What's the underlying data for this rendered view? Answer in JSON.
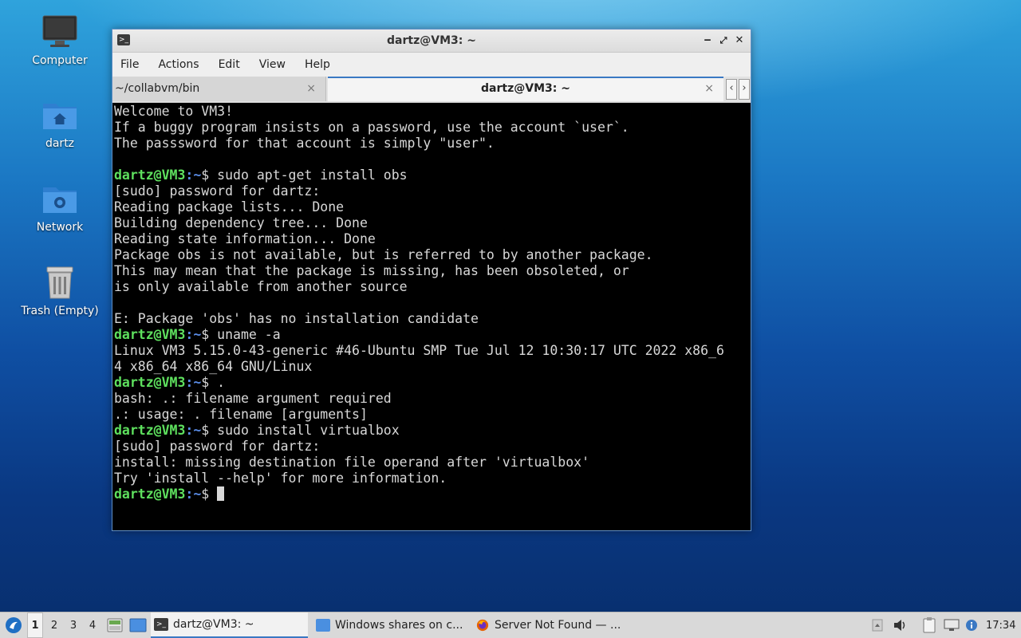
{
  "desktop": {
    "icons": [
      {
        "label": "Computer"
      },
      {
        "label": "dartz"
      },
      {
        "label": "Network"
      },
      {
        "label": "Trash (Empty)"
      }
    ]
  },
  "window": {
    "title": "dartz@VM3: ~",
    "controls": {
      "minimize": "‒",
      "maximize": "⤢",
      "close": "✕"
    },
    "menu": [
      "File",
      "Actions",
      "Edit",
      "View",
      "Help"
    ],
    "tabs": [
      {
        "label": "~/collabvm/bin",
        "active": false
      },
      {
        "label": "dartz@VM3: ~",
        "active": true
      }
    ],
    "tab_close_glyph": "×",
    "tab_nav": {
      "prev": "‹",
      "next": "›"
    }
  },
  "terminal": {
    "prompt_user": "dartz@VM3",
    "prompt_path": ":~",
    "prompt_symbol": "$ ",
    "lines": [
      {
        "text": "Welcome to VM3!"
      },
      {
        "text": "If a buggy program insists on a password, use the account `user`."
      },
      {
        "text": "The passsword for that account is simply \"user\"."
      },
      {
        "text": ""
      },
      {
        "prompt": true,
        "text": "sudo apt-get install obs"
      },
      {
        "text": "[sudo] password for dartz:"
      },
      {
        "text": "Reading package lists... Done"
      },
      {
        "text": "Building dependency tree... Done"
      },
      {
        "text": "Reading state information... Done"
      },
      {
        "text": "Package obs is not available, but is referred to by another package."
      },
      {
        "text": "This may mean that the package is missing, has been obsoleted, or"
      },
      {
        "text": "is only available from another source"
      },
      {
        "text": ""
      },
      {
        "text": "E: Package 'obs' has no installation candidate"
      },
      {
        "prompt": true,
        "text": "uname -a"
      },
      {
        "text": "Linux VM3 5.15.0-43-generic #46-Ubuntu SMP Tue Jul 12 10:30:17 UTC 2022 x86_6"
      },
      {
        "text": "4 x86_64 x86_64 GNU/Linux"
      },
      {
        "prompt": true,
        "text": "."
      },
      {
        "text": "bash: .: filename argument required"
      },
      {
        "text": ".: usage: . filename [arguments]"
      },
      {
        "prompt": true,
        "text": "sudo install virtualbox"
      },
      {
        "text": "[sudo] password for dartz:"
      },
      {
        "text": "install: missing destination file operand after 'virtualbox'"
      },
      {
        "text": "Try 'install --help' for more information."
      },
      {
        "prompt": true,
        "text": "",
        "cursor": true
      }
    ]
  },
  "taskbar": {
    "workspaces": [
      "1",
      "2",
      "3",
      "4"
    ],
    "active_workspace": "1",
    "tasks": [
      {
        "label": "dartz@VM3: ~",
        "icon": "terminal-icon",
        "active": true
      },
      {
        "label": "Windows shares on c...",
        "icon": "folder-icon",
        "active": false
      },
      {
        "label": "Server Not Found — ...",
        "icon": "firefox-icon",
        "active": false
      }
    ],
    "clock": "17:34"
  },
  "colors": {
    "prompt_user": "#5ee05e",
    "prompt_path": "#5a8ce6",
    "accent": "#3a78c3"
  }
}
